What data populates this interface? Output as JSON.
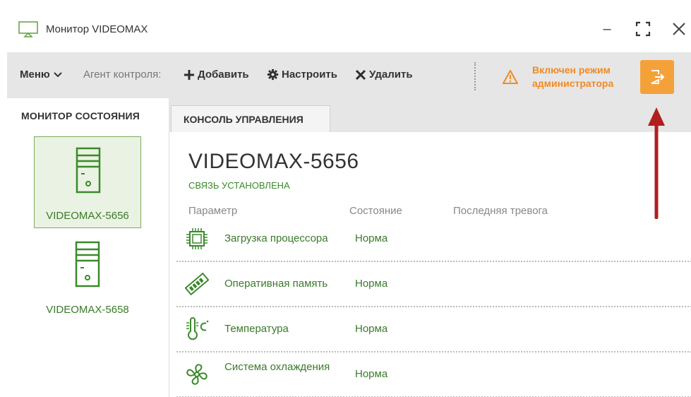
{
  "window": {
    "title": "Монитор VIDEOMAX",
    "minimize_glyph": "–",
    "maximize_glyph": "⛶",
    "close_glyph": "✕"
  },
  "toolbar": {
    "menu_label": "Меню",
    "agent_label": "Агент контроля:",
    "add_label": "Добавить",
    "configure_label": "Настроить",
    "delete_label": "Удалить",
    "admin_mode_text": "Включен режим администратора",
    "exit_icon": "logout-icon"
  },
  "sidebar": {
    "tab_label": "МОНИТОР СОСТОЯНИЯ",
    "devices": [
      {
        "label": "VIDEOMAX-5656",
        "selected": true
      },
      {
        "label": "VIDEOMAX-5658",
        "selected": false
      }
    ]
  },
  "main": {
    "tab_label": "КОНСОЛЬ УПРАВЛЕНИЯ",
    "host_name": "VIDEOMAX-5656",
    "connection_status": "СВЯЗЬ УСТАНОВЛЕНА",
    "columns": [
      "Параметр",
      "Состояние",
      "Последняя тревога"
    ],
    "rows": [
      {
        "icon": "cpu-icon",
        "name": "Загрузка процессора",
        "state": "Норма",
        "last_alarm": ""
      },
      {
        "icon": "memory-icon",
        "name": "Оперативная память",
        "state": "Норма",
        "last_alarm": ""
      },
      {
        "icon": "thermometer-icon",
        "name": "Температура",
        "state": "Норма",
        "last_alarm": ""
      },
      {
        "icon": "fan-icon",
        "name": "Система охлаждения",
        "state": "Норма",
        "last_alarm": ""
      }
    ]
  },
  "colors": {
    "accent_orange": "#f5a13a",
    "admin_text": "#f08a24",
    "ok_green": "#3a7a2a",
    "arrow_red": "#b21e1e"
  }
}
